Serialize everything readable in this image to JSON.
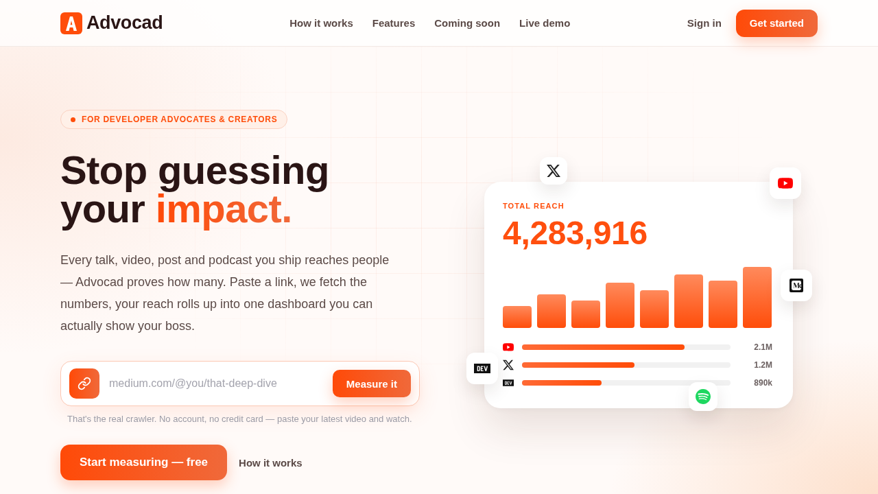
{
  "nav": {
    "brand": "Advocad",
    "links": [
      "How it works",
      "Features",
      "Coming soon",
      "Live demo"
    ],
    "sign_in": "Sign in",
    "cta": "Get started"
  },
  "hero": {
    "tag": "FOR DEVELOPER ADVOCATES & CREATORS",
    "headline": {
      "text": "Stop guessing your",
      "accent": "impact."
    },
    "description": "Every talk, video, post and podcast you ship reaches people — Advocad proves how many. Paste a link, we fetch the numbers, your reach rolls up into one dashboard you can actually show your boss.",
    "url_form": {
      "placeholder": "medium.com/@you/that-deep-dive",
      "button": "Measure it"
    },
    "hint": "That's the real crawler. No account, no credit card — paste your latest video and watch.",
    "primary_button": "Start measuring — free",
    "secondary_link": "How it works"
  },
  "reach_card": {
    "label": "TOTAL REACH",
    "total": "4,283,916",
    "platforms": [
      {
        "kind": "youtube",
        "level": 0.78,
        "value": "2.1M"
      },
      {
        "kind": "x",
        "level": 0.54,
        "value": "1.2M"
      },
      {
        "kind": "dev",
        "level": 0.38,
        "value": "890k"
      }
    ],
    "floating_badges": [
      {
        "kind": "x"
      },
      {
        "kind": "youtube"
      },
      {
        "kind": "medium"
      },
      {
        "kind": "dev"
      },
      {
        "kind": "spotify"
      }
    ]
  }
}
